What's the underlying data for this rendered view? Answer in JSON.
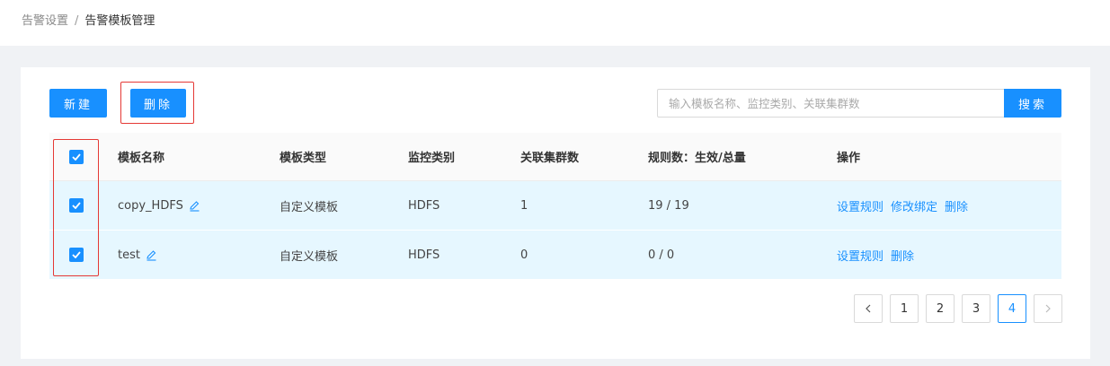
{
  "breadcrumb": {
    "parent": "告警设置",
    "separator": "/",
    "current": "告警模板管理"
  },
  "toolbar": {
    "new_label": "新建",
    "delete_label": "删除"
  },
  "search": {
    "placeholder": "输入模板名称、监控类别、关联集群数",
    "value": "",
    "button_label": "搜索"
  },
  "table": {
    "columns": [
      "模板名称",
      "模板类型",
      "监控类别",
      "关联集群数",
      "规则数：生效/总量",
      "操作"
    ],
    "header_checked": true,
    "rows": [
      {
        "checked": true,
        "name": "copy_HDFS",
        "type": "自定义模板",
        "category": "HDFS",
        "clusters": "1",
        "rules": "19 / 19",
        "actions": [
          "设置规则",
          "修改绑定",
          "删除"
        ]
      },
      {
        "checked": true,
        "name": "test",
        "type": "自定义模板",
        "category": "HDFS",
        "clusters": "0",
        "rules": "0 / 0",
        "actions": [
          "设置规则",
          "删除"
        ]
      }
    ]
  },
  "pagination": {
    "prev": "<",
    "pages": [
      "1",
      "2",
      "3",
      "4"
    ],
    "current": "4",
    "next": ">"
  },
  "colors": {
    "primary": "#1890ff",
    "highlight_border": "#e53935",
    "selected_row_bg": "#e6f7ff"
  },
  "icons": {
    "checkbox": "check-icon",
    "edit": "pencil-icon",
    "prev": "chevron-left-icon",
    "next": "chevron-right-icon"
  }
}
